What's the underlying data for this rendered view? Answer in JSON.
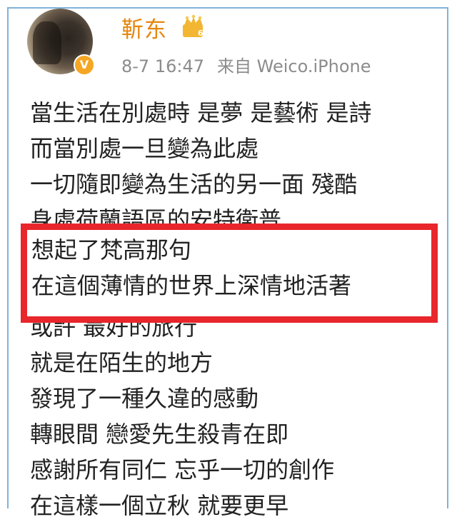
{
  "post": {
    "author": "靳东",
    "time": "8-7 16:47",
    "source": "来自 Weico.iPhone",
    "badge_icon": "crown-badge-icon",
    "verified_icon": "verified-v-icon",
    "accent_color": "#e6870f"
  },
  "lines_before": [
    "當生活在別處時 是夢 是藝術 是詩",
    "而當別處一旦變為此處",
    "一切隨即變為生活的另一面 殘酷",
    "身處荷蘭語區的安特衛普"
  ],
  "highlight": {
    "border_color": "#e8262b",
    "lines": [
      "想起了梵高那句",
      "在這個薄情的世界上深情地活著"
    ]
  },
  "lines_after": [
    "或許 最好的旅行",
    "就是在陌生的地方",
    "發現了一種久違的感動",
    "轉眼間 戀愛先生殺青在即",
    "感謝所有同仁 忘乎一切的創作",
    "在這樣一個立秋 就要更早"
  ]
}
